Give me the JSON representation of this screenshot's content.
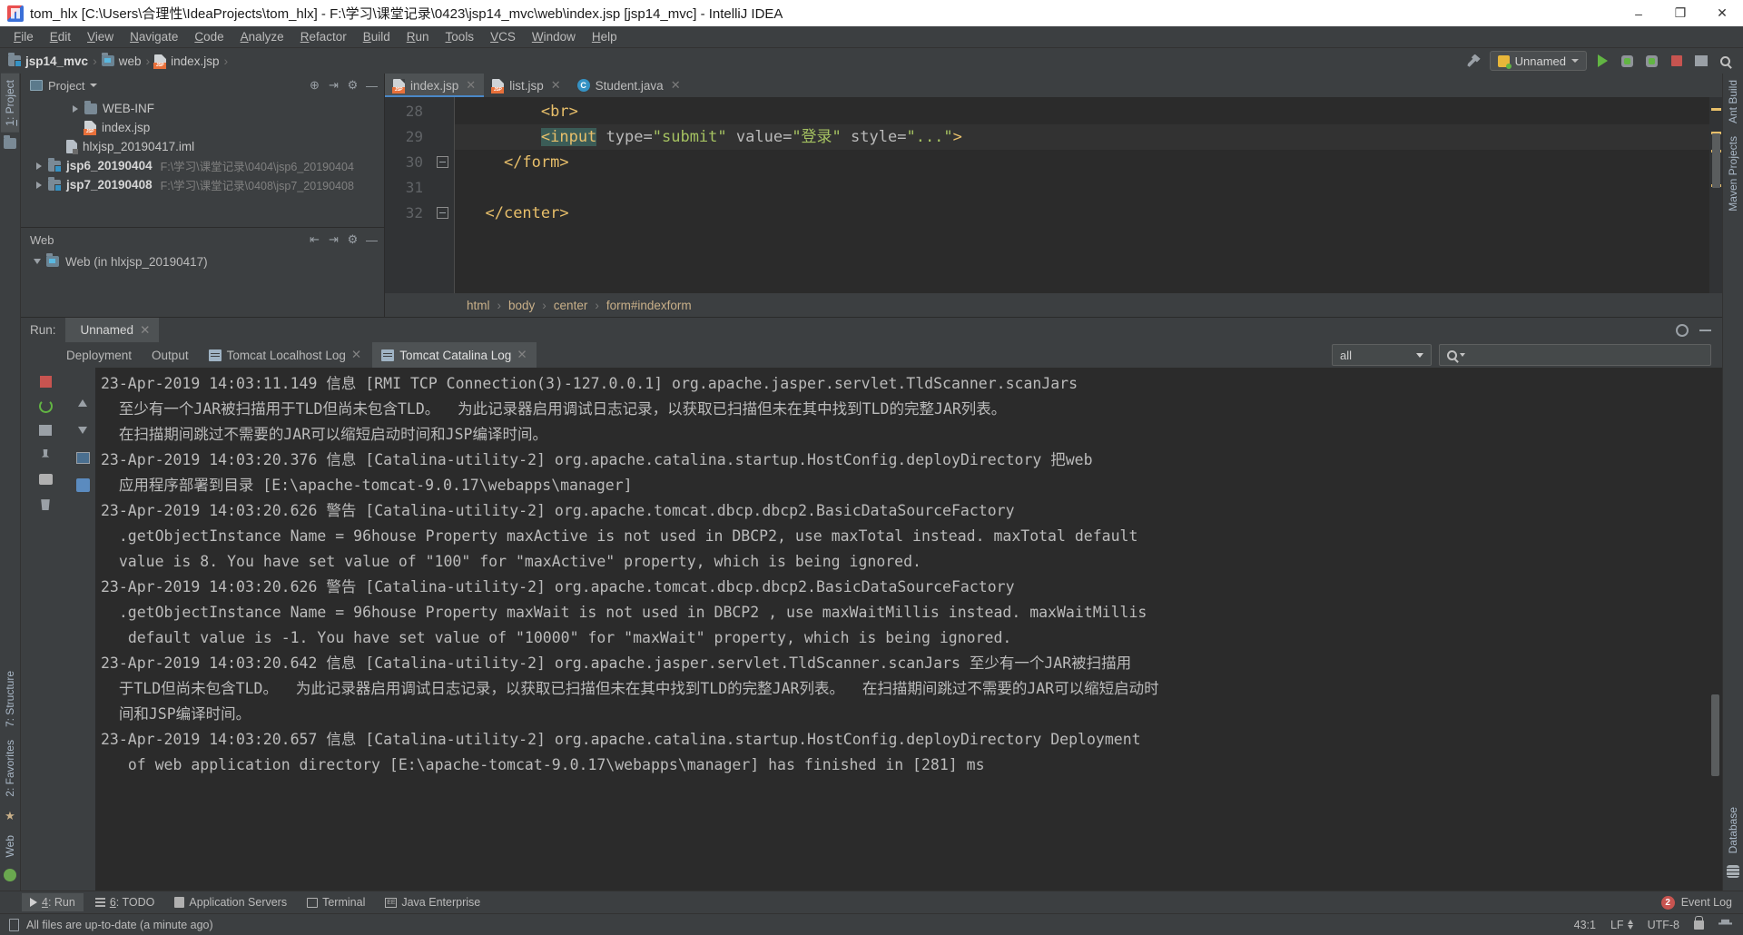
{
  "window": {
    "title": "tom_hlx [C:\\Users\\合理性\\IdeaProjects\\tom_hlx] - F:\\学习\\课堂记录\\0423\\jsp14_mvc\\web\\index.jsp [jsp14_mvc] - IntelliJ IDEA",
    "minimize": "–",
    "maximize": "❐",
    "close": "✕"
  },
  "menu": [
    "File",
    "Edit",
    "View",
    "Navigate",
    "Code",
    "Analyze",
    "Refactor",
    "Build",
    "Run",
    "Tools",
    "VCS",
    "Window",
    "Help"
  ],
  "navbar": {
    "crumbs": [
      "jsp14_mvc",
      "web",
      "index.jsp"
    ],
    "run_config": "Unnamed"
  },
  "left_strip": [
    {
      "label": "1: Project",
      "underline": "1"
    }
  ],
  "right_strip": [
    "Ant Build",
    "Maven Projects",
    "Database"
  ],
  "left_bottom_strip": [
    "7: Structure",
    "2: Favorites",
    "Web"
  ],
  "project": {
    "title": "Project",
    "tree": [
      {
        "indent": 2,
        "arrow": true,
        "icon": "folder",
        "label": "WEB-INF",
        "bold": false,
        "path": ""
      },
      {
        "indent": 2,
        "arrow": false,
        "icon": "jsp",
        "label": "index.jsp",
        "bold": false,
        "path": ""
      },
      {
        "indent": 1,
        "arrow": false,
        "icon": "iml",
        "label": "hlxjsp_20190417.iml",
        "bold": false,
        "path": ""
      },
      {
        "indent": 0,
        "arrow": true,
        "icon": "module",
        "label": "jsp6_20190404",
        "bold": true,
        "path": "F:\\学习\\课堂记录\\0404\\jsp6_20190404"
      },
      {
        "indent": 0,
        "arrow": true,
        "icon": "module",
        "label": "jsp7_20190408",
        "bold": true,
        "path": "F:\\学习\\课堂记录\\0408\\jsp7_20190408"
      }
    ]
  },
  "web_panel": {
    "title": "Web",
    "root": "Web (in hlxjsp_20190417)"
  },
  "editor": {
    "tabs": [
      {
        "label": "index.jsp",
        "icon": "jsp",
        "active": true,
        "close": "✕"
      },
      {
        "label": "list.jsp",
        "icon": "jsp",
        "active": false,
        "close": "✕"
      },
      {
        "label": "Student.java",
        "icon": "java",
        "active": false,
        "close": "✕"
      }
    ],
    "lines": [
      {
        "num": "28",
        "fold": "",
        "segments": [
          {
            "t": "        ",
            "c": "plain"
          },
          {
            "t": "<br>",
            "c": "tag"
          }
        ],
        "current": false
      },
      {
        "num": "29",
        "fold": "",
        "segments": [
          {
            "t": "        ",
            "c": "plain"
          },
          {
            "t": "<input",
            "c": "sel"
          },
          {
            "t": " ",
            "c": "plain"
          },
          {
            "t": "type=",
            "c": "attr"
          },
          {
            "t": "\"submit\"",
            "c": "str"
          },
          {
            "t": " ",
            "c": "plain"
          },
          {
            "t": "value=",
            "c": "attr"
          },
          {
            "t": "\"登录\"",
            "c": "str"
          },
          {
            "t": " ",
            "c": "plain"
          },
          {
            "t": "style=",
            "c": "attr"
          },
          {
            "t": "\"...\"",
            "c": "str"
          },
          {
            "t": ">",
            "c": "tag"
          }
        ],
        "current": true
      },
      {
        "num": "30",
        "fold": "minus",
        "segments": [
          {
            "t": "    ",
            "c": "plain"
          },
          {
            "t": "</form>",
            "c": "tag"
          }
        ],
        "current": false
      },
      {
        "num": "31",
        "fold": "",
        "segments": [
          {
            "t": "",
            "c": "plain"
          }
        ],
        "current": false
      },
      {
        "num": "32",
        "fold": "minus",
        "segments": [
          {
            "t": "  ",
            "c": "plain"
          },
          {
            "t": "</center>",
            "c": "tag"
          }
        ],
        "current": false
      }
    ],
    "breadcrumbs": [
      "html",
      "body",
      "center",
      "form#indexform"
    ]
  },
  "run_window": {
    "label": "Run:",
    "tab": "Unnamed",
    "tab_close": "✕",
    "sub_tabs": [
      {
        "label": "Deployment",
        "icon": "",
        "active": false,
        "close": ""
      },
      {
        "label": "Output",
        "icon": "",
        "active": false,
        "close": ""
      },
      {
        "label": "Tomcat Localhost Log",
        "icon": "log",
        "active": false,
        "close": "✕"
      },
      {
        "label": "Tomcat Catalina Log",
        "icon": "log",
        "active": true,
        "close": "✕"
      }
    ],
    "filter_level": "all",
    "search_placeholder": "",
    "console_lines": [
      "23-Apr-2019 14:03:11.149 信息 [RMI TCP Connection(3)-127.0.0.1] org.apache.jasper.servlet.TldScanner.scanJars",
      "  至少有一个JAR被扫描用于TLD但尚未包含TLD。  为此记录器启用调试日志记录，以获取已扫描但未在其中找到TLD的完整JAR列表。",
      "  在扫描期间跳过不需要的JAR可以缩短启动时间和JSP编译时间。",
      "23-Apr-2019 14:03:20.376 信息 [Catalina-utility-2] org.apache.catalina.startup.HostConfig.deployDirectory 把web",
      "  应用程序部署到目录 [E:\\apache-tomcat-9.0.17\\webapps\\manager]",
      "23-Apr-2019 14:03:20.626 警告 [Catalina-utility-2] org.apache.tomcat.dbcp.dbcp2.BasicDataSourceFactory",
      "  .getObjectInstance Name = 96house Property maxActive is not used in DBCP2, use maxTotal instead. maxTotal default",
      "  value is 8. You have set value of \"100\" for \"maxActive\" property, which is being ignored.",
      "23-Apr-2019 14:03:20.626 警告 [Catalina-utility-2] org.apache.tomcat.dbcp.dbcp2.BasicDataSourceFactory",
      "  .getObjectInstance Name = 96house Property maxWait is not used in DBCP2 , use maxWaitMillis instead. maxWaitMillis",
      "   default value is -1. You have set value of \"10000\" for \"maxWait\" property, which is being ignored.",
      "23-Apr-2019 14:03:20.642 信息 [Catalina-utility-2] org.apache.jasper.servlet.TldScanner.scanJars 至少有一个JAR被扫描用",
      "  于TLD但尚未包含TLD。  为此记录器启用调试日志记录，以获取已扫描但未在其中找到TLD的完整JAR列表。  在扫描期间跳过不需要的JAR可以缩短启动时",
      "  间和JSP编译时间。",
      "23-Apr-2019 14:03:20.657 信息 [Catalina-utility-2] org.apache.catalina.startup.HostConfig.deployDirectory Deployment",
      "   of web application directory [E:\\apache-tomcat-9.0.17\\webapps\\manager] has finished in [281] ms"
    ]
  },
  "bottom_bar": {
    "items": [
      {
        "label": "4: Run",
        "underline": "4",
        "icon": "run-icon",
        "selected": true
      },
      {
        "label": "6: TODO",
        "underline": "6",
        "icon": "todo-icon",
        "selected": false
      },
      {
        "label": "Application Servers",
        "underline": "",
        "icon": "server-icon",
        "selected": false
      },
      {
        "label": "Terminal",
        "underline": "",
        "icon": "terminal-icon",
        "selected": false
      },
      {
        "label": "Java Enterprise",
        "underline": "",
        "icon": "ee-icon",
        "selected": false
      }
    ],
    "event_log": "Event Log",
    "event_count": "2"
  },
  "status_bar": {
    "message": "All files are up-to-date (a minute ago)",
    "caret": "43:1",
    "line_sep": "LF",
    "encoding": "UTF-8"
  },
  "colors": {
    "accent_blue": "#4a88c7",
    "tab_active": "#4e5254",
    "editor_bg": "#2b2b2b",
    "panel_bg": "#3c3f41",
    "string_green": "#a5c261",
    "tag_yellow": "#e8bf6a",
    "error_red": "#c75450",
    "ok_green": "#62b543"
  }
}
